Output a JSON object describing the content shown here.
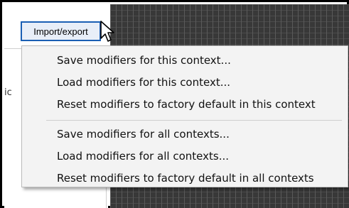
{
  "toolbar": {
    "import_export_label": "Import/export"
  },
  "left_panel": {
    "fragment": "ic"
  },
  "menu": {
    "group_context": [
      "Save modifiers for this context...",
      "Load modifiers for this context...",
      "Reset modifiers to factory default in this context"
    ],
    "group_all": [
      "Save modifiers for all contexts...",
      "Load modifiers for all contexts...",
      "Reset modifiers to factory default in all contexts"
    ]
  },
  "colors": {
    "button_border": "#1a5fb4",
    "menu_bg": "#f3f3f3",
    "grid_bg": "#383838"
  },
  "icons": {
    "cursor": "mouse-pointer-icon"
  }
}
